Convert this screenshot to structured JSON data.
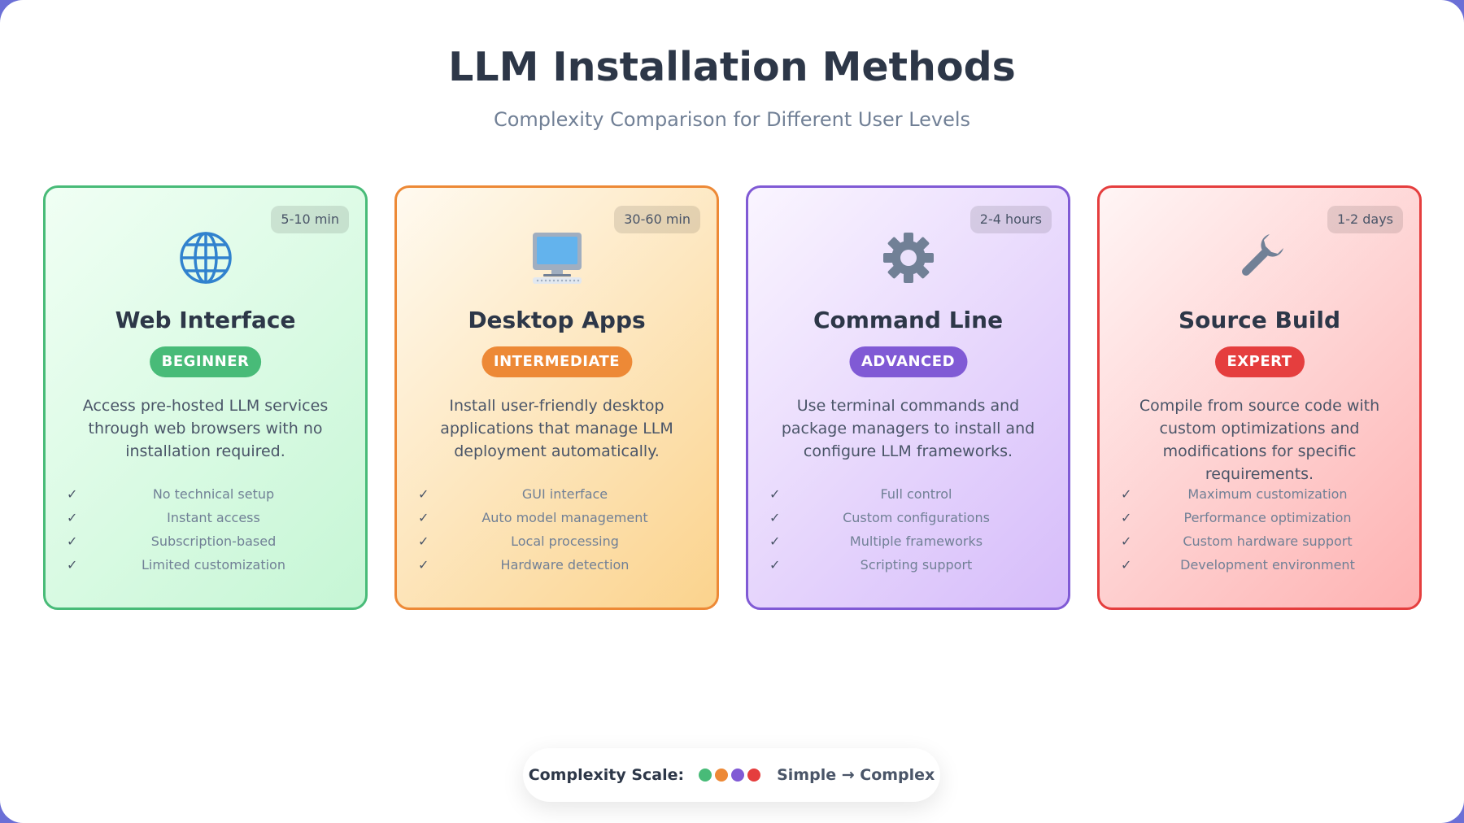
{
  "header": {
    "title": "LLM Installation Methods",
    "subtitle": "Complexity Comparison for Different User Levels"
  },
  "cards": [
    {
      "icon": "globe-icon",
      "time": "5-10 min",
      "title": "Web Interface",
      "level": "BEGINNER",
      "level_color": "#48bb78",
      "border_color": "#48bb78",
      "description": "Access pre-hosted LLM services through web browsers with no installation required.",
      "features": [
        "No technical setup",
        "Instant access",
        "Subscription-based",
        "Limited customization"
      ]
    },
    {
      "icon": "desktop-computer-icon",
      "time": "30-60 min",
      "title": "Desktop Apps",
      "level": "INTERMEDIATE",
      "level_color": "#ed8936",
      "border_color": "#ed8936",
      "description": "Install user-friendly desktop applications that manage LLM deployment automatically.",
      "features": [
        "GUI interface",
        "Auto model management",
        "Local processing",
        "Hardware detection"
      ]
    },
    {
      "icon": "gear-icon",
      "time": "2-4 hours",
      "title": "Command Line",
      "level": "ADVANCED",
      "level_color": "#805ad5",
      "border_color": "#805ad5",
      "description": "Use terminal commands and package managers to install and configure LLM frameworks.",
      "features": [
        "Full control",
        "Custom configurations",
        "Multiple frameworks",
        "Scripting support"
      ]
    },
    {
      "icon": "wrench-icon",
      "time": "1-2 days",
      "title": "Source Build",
      "level": "EXPERT",
      "level_color": "#e53e3e",
      "border_color": "#e53e3e",
      "description": "Compile from source code with custom optimizations and modifications for specific requirements.",
      "features": [
        "Maximum customization",
        "Performance optimization",
        "Custom hardware support",
        "Development environment"
      ]
    }
  ],
  "check_glyph": "✓",
  "legend": {
    "label": "Complexity Scale:",
    "colors": [
      "#48bb78",
      "#ed8936",
      "#805ad5",
      "#e53e3e"
    ],
    "range": "Simple → Complex"
  }
}
